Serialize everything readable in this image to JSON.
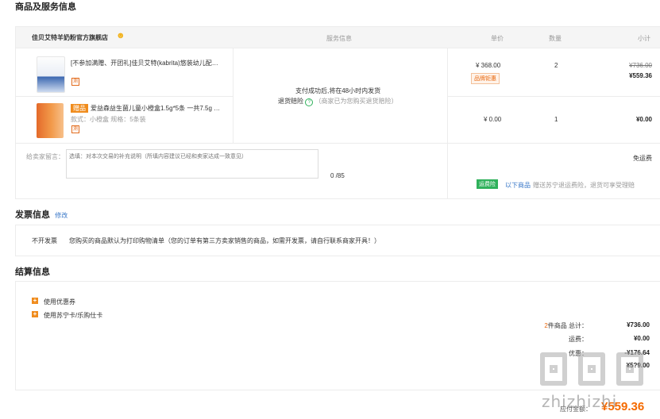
{
  "product_service": {
    "title": "商品及服务信息",
    "store_name": "佳贝艾特羊奶粉官方旗舰店",
    "columns": {
      "service": "服务信息",
      "price": "单价",
      "qty": "数量",
      "subtotal": "小计"
    },
    "items": [
      {
        "name": "[不参加满赠、开团礼]佳贝艾特(kabrita)悠装幼儿配…",
        "tag": "测",
        "price": "¥ 368.00",
        "promo": "品牌钜惠",
        "qty": "2",
        "original_total": "¥736.00",
        "total": "¥559.36"
      },
      {
        "gift_label": "赠品",
        "name": "爱益森益生菌儿童小橙盒1.5g*5条 一共7.5g …",
        "spec": "款式：小橙盒  规格：5条装",
        "tag": "测",
        "price": "¥ 0.00",
        "qty": "1",
        "total": "¥0.00"
      }
    ],
    "service_info": {
      "ship_note": "支付成功后,将在48小时内发货",
      "return_ins_label": "退货赔险",
      "return_ins_note": "（商家已为您购买退货赔险）"
    },
    "message": {
      "label": "给卖家留言：",
      "placeholder": "选填：对本次交易的补充说明（所填内容建议已经和卖家达成一致意见）",
      "counter": "0 /85"
    },
    "shipping": {
      "label": "免运费",
      "badge": "运费险",
      "link": "以下商品",
      "note": "赠送苏宁退运费险，退货可享受理赔"
    }
  },
  "invoice": {
    "title": "发票信息",
    "edit": "修改",
    "type": "不开发票",
    "note": "您购买的商品默认为打印购物清单（您的订单有第三方卖家销售的商品，如需开发票，请自行联系商家开具！）"
  },
  "settlement": {
    "title": "结算信息",
    "options": [
      "使用优惠券",
      "使用苏宁卡/乐购仕卡"
    ],
    "summary": {
      "count": "2",
      "count_suffix": "件商品 总计：",
      "total": "¥736.00",
      "shipping_label": "运费：",
      "shipping": "¥0.00",
      "discount_label": "优惠：",
      "discount": "-¥176.64",
      "partial": "¥5?9.00",
      "pay_label": "应付金额：",
      "pay": "¥559.36"
    }
  },
  "watermark": "zhizhizhi"
}
